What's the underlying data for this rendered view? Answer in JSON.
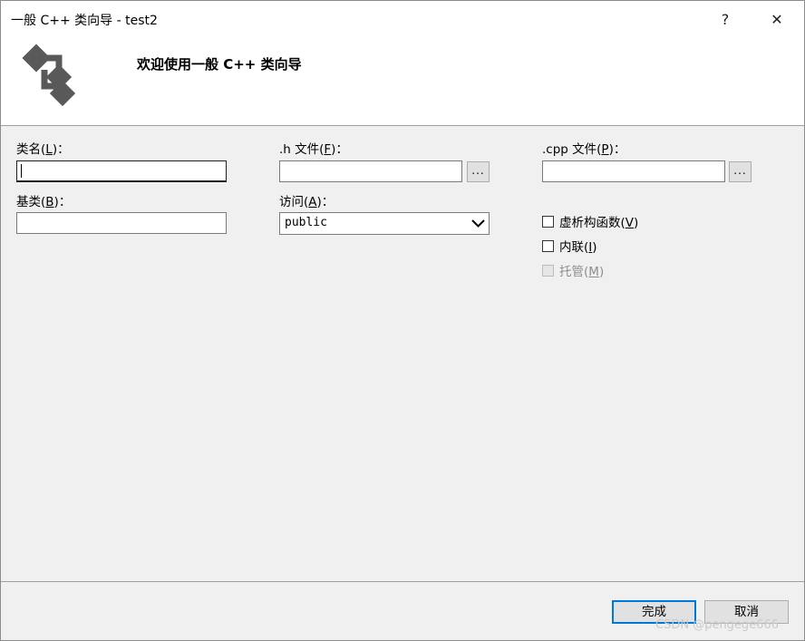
{
  "window": {
    "title": "一般 C++ 类向导 - test2",
    "help_glyph": "?",
    "close_glyph": "✕"
  },
  "header": {
    "welcome": "欢迎使用一般 C++ 类向导",
    "logo_icon": "class-wizard-icon"
  },
  "form": {
    "class_name": {
      "label_prefix": "类名(",
      "mnemonic": "L",
      "label_suffix": ")：",
      "value": ""
    },
    "h_file": {
      "label_prefix": ".h 文件(",
      "mnemonic": "F",
      "label_suffix": ")：",
      "value": "",
      "browse_label": "..."
    },
    "cpp_file": {
      "label_prefix": ".cpp 文件(",
      "mnemonic": "P",
      "label_suffix": ")：",
      "value": "",
      "browse_label": "..."
    },
    "base_class": {
      "label_prefix": "基类(",
      "mnemonic": "B",
      "label_suffix": ")：",
      "value": ""
    },
    "access": {
      "label_prefix": "访问(",
      "mnemonic": "A",
      "label_suffix": ")：",
      "selected": "public"
    }
  },
  "options": {
    "virtual_destructor": {
      "label_prefix": "虚析构函数(",
      "mnemonic": "V",
      "label_suffix": ")",
      "checked": false,
      "disabled": false
    },
    "inline": {
      "label_prefix": "内联(",
      "mnemonic": "I",
      "label_suffix": ")",
      "checked": false,
      "disabled": false
    },
    "managed": {
      "label_prefix": "托管(",
      "mnemonic": "M",
      "label_suffix": ")",
      "checked": false,
      "disabled": true
    }
  },
  "buttons": {
    "finish": "完成",
    "cancel": "取消"
  },
  "watermark": "CSDN @pengege666",
  "colors": {
    "background": "#f0f0f0",
    "header": "#ffffff",
    "accent": "#0078d7",
    "disabled_text": "#8d8d8d"
  }
}
